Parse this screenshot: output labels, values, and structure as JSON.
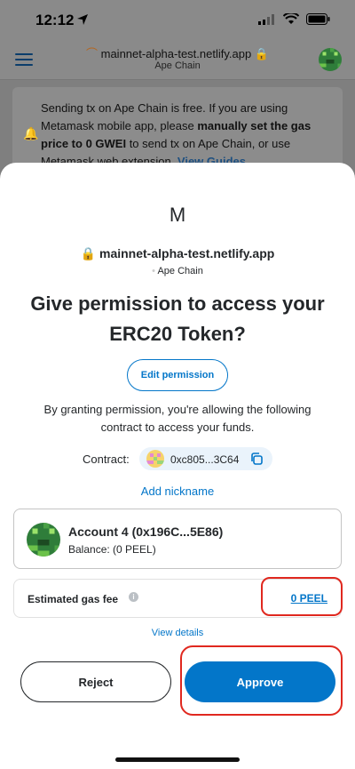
{
  "status_bar": {
    "time": "12:12"
  },
  "browser": {
    "url": "mainnet-alpha-test.netlify.app",
    "network": "Ape Chain"
  },
  "banner": {
    "text_1": "Sending tx on Ape Chain is free. If you are using Metamask mobile app, please ",
    "text_bold": "manually set the gas price to 0 GWEI",
    "text_2": " to send tx on Ape Chain, or use Metamask web extension. ",
    "link": "View Guides"
  },
  "modal": {
    "logo": "M",
    "site": "mainnet-alpha-test.netlify.app",
    "network": "Ape Chain",
    "title": "Give permission to access your ERC20 Token?",
    "edit_permission": "Edit permission",
    "description": "By granting permission, you're allowing the following contract to access your funds.",
    "contract_label": "Contract:",
    "contract_address": "0xc805...3C64",
    "add_nickname": "Add nickname",
    "account": {
      "name": "Account 4 (0x196C...5E86)",
      "balance": "Balance:  (0 PEEL)"
    },
    "gas": {
      "label": "Estimated gas fee",
      "value": "0 PEEL"
    },
    "view_details": "View details",
    "reject": "Reject",
    "approve": "Approve"
  },
  "colors": {
    "accent": "#0376c9",
    "highlight": "#e0281f",
    "text": "#24272a"
  }
}
